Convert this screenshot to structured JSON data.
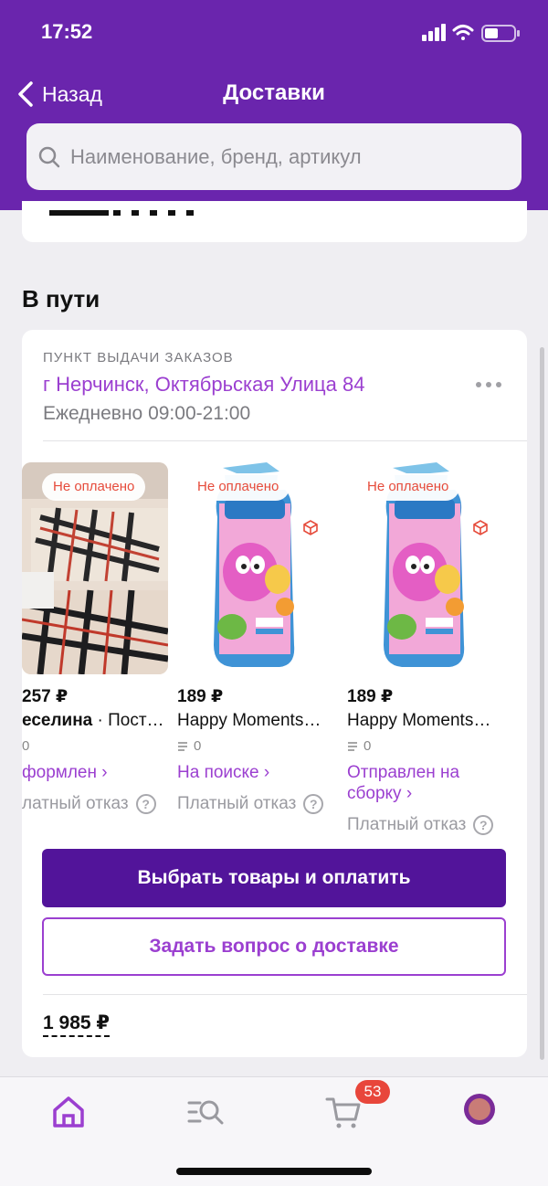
{
  "status_bar": {
    "time": "17:52"
  },
  "nav": {
    "back_label": "Назад",
    "title": "Доставки"
  },
  "search": {
    "placeholder": "Наименование, бренд, артикул"
  },
  "section": {
    "title": "В пути"
  },
  "delivery": {
    "pickup_label": "ПУНКТ ВЫДАЧИ ЗАКАЗОВ",
    "address": "г Нерчинск, Октябрьская Улица 84",
    "hours": "Ежедневно 09:00-21:00",
    "products": [
      {
        "badge": "Не оплачено",
        "price": "257 ₽",
        "brand": "еселина",
        "name_rest": " · Пост…",
        "rating": "0",
        "status": "формлен ›",
        "refusal": "латный отказ"
      },
      {
        "badge": "Не оплачено",
        "price": "189 ₽",
        "brand": "Happy Moments",
        "name_rest": "…",
        "rating": "0",
        "status": "На поиске ›",
        "refusal": "Платный отказ"
      },
      {
        "badge": "Не оплачено",
        "price": "189 ₽",
        "brand": "Happy Moments",
        "name_rest": "…",
        "rating": "0",
        "status": "Отправлен на сборку ›",
        "refusal": "Платный отказ"
      }
    ],
    "pay_button": "Выбрать товары и оплатить",
    "ask_button": "Задать вопрос о доставке",
    "total": "1 985 ₽"
  },
  "tabbar": {
    "cart_count": "53"
  },
  "colors": {
    "brand_purple": "#6a25ad",
    "accent_purple": "#9b3fd0",
    "button_dark": "#52149a",
    "badge_red": "#e8463b"
  }
}
